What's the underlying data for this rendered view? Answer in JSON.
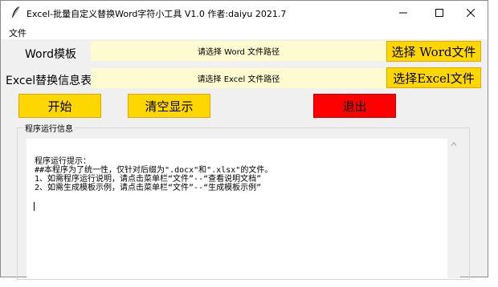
{
  "window": {
    "title": "Excel-批量自定义替换Word字符小工具 V1.0  作者:daiyu 2021.7",
    "icon": "feather-icon"
  },
  "menu": {
    "file": "文件"
  },
  "word_row": {
    "label": "Word模板",
    "placeholder": "请选择 Word 文件路径",
    "button": "选择 Word文件"
  },
  "excel_row": {
    "label": "Excel替换信息表",
    "placeholder": "请选择 Excel 文件路径",
    "button": "选择Excel文件"
  },
  "actions": {
    "start": "开始",
    "clear": "清空显示",
    "exit": "退出"
  },
  "log": {
    "group_title": "程序运行信息",
    "text": "程序运行提示：\n##本程序为了统一性，仅针对后缀为\".docx\"和\".xlsx\"的文件。\n1、如需程序运行说明，请点击菜单栏“文件”--“查看说明文档”\n2、如需生成模板示例，请点击菜单栏“文件”--“生成模板示例”"
  },
  "colors": {
    "path_field": "#fffbd0",
    "button_yellow": "#ffd700",
    "button_red": "#ff0000"
  }
}
